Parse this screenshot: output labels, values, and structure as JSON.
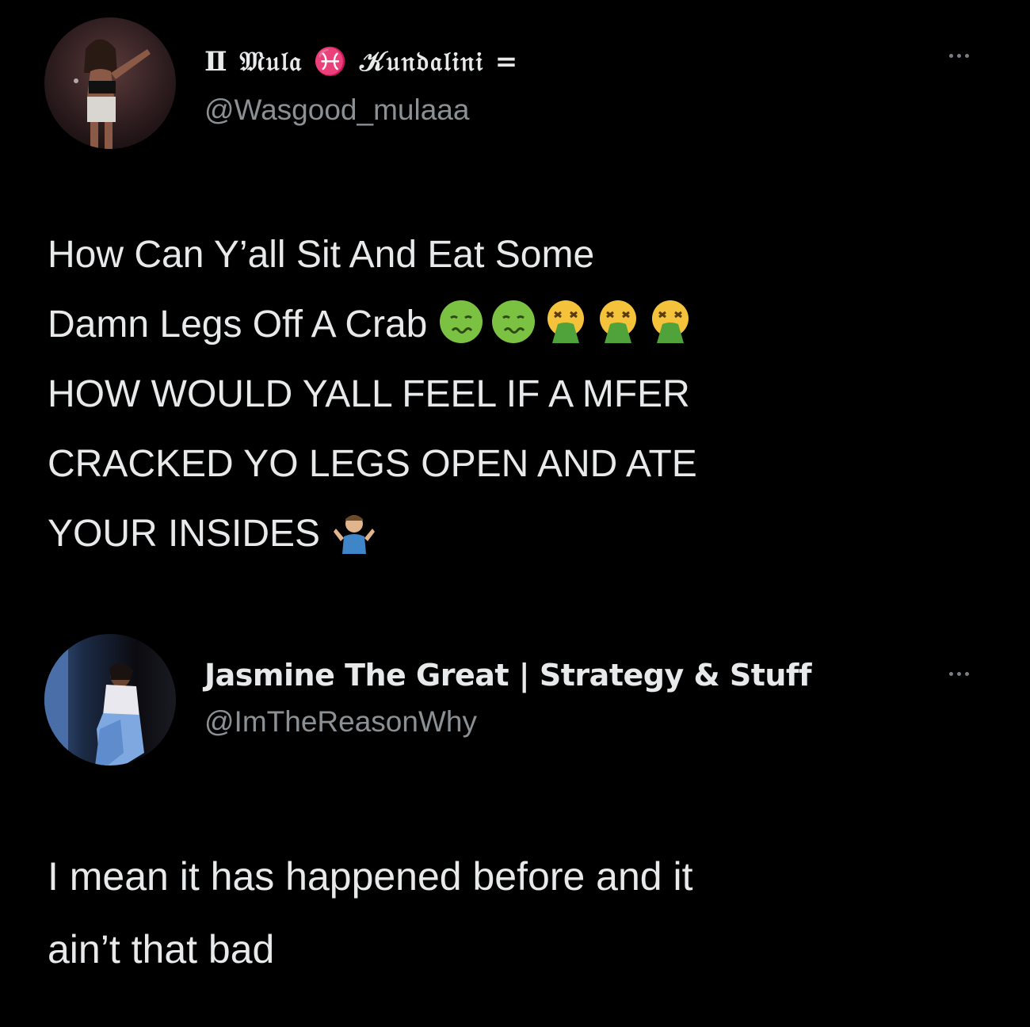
{
  "tweets": [
    {
      "display_name": "Ⅱ 𝔐𝔲𝔩𝔞 ♓ 𝒦𝔲𝔫𝔡𝔞𝔩𝔦𝔫𝔦 =",
      "handle": "@Wasgood_mulaaa",
      "lines": [
        "How Can Y’all Sit And Eat Some",
        "Damn Legs Off A Crab",
        "HOW WOULD YALL FEEL IF A MFER",
        "CRACKED YO LEGS OPEN AND ATE",
        "YOUR INSIDES"
      ],
      "line2_emojis": [
        "nauseated-face-icon",
        "nauseated-face-icon",
        "vomiting-face-icon",
        "vomiting-face-icon",
        "vomiting-face-icon"
      ],
      "line5_emoji": "person-shrugging-icon",
      "more_icon": "more-options-icon"
    },
    {
      "display_name": "Jasmine The Great | Strategy & Stuff",
      "handle": "@ImTheReasonWhy",
      "lines": [
        "I mean it has happened before and it",
        "ain’t that bad"
      ],
      "more_icon": "more-options-icon"
    }
  ],
  "colors": {
    "background": "#000000",
    "text": "#e7e9ea",
    "handle": "#8b9095",
    "nauseated_green": "#7cc242",
    "vomit_green": "#4fa33a",
    "face_yellow": "#f5c33b"
  }
}
